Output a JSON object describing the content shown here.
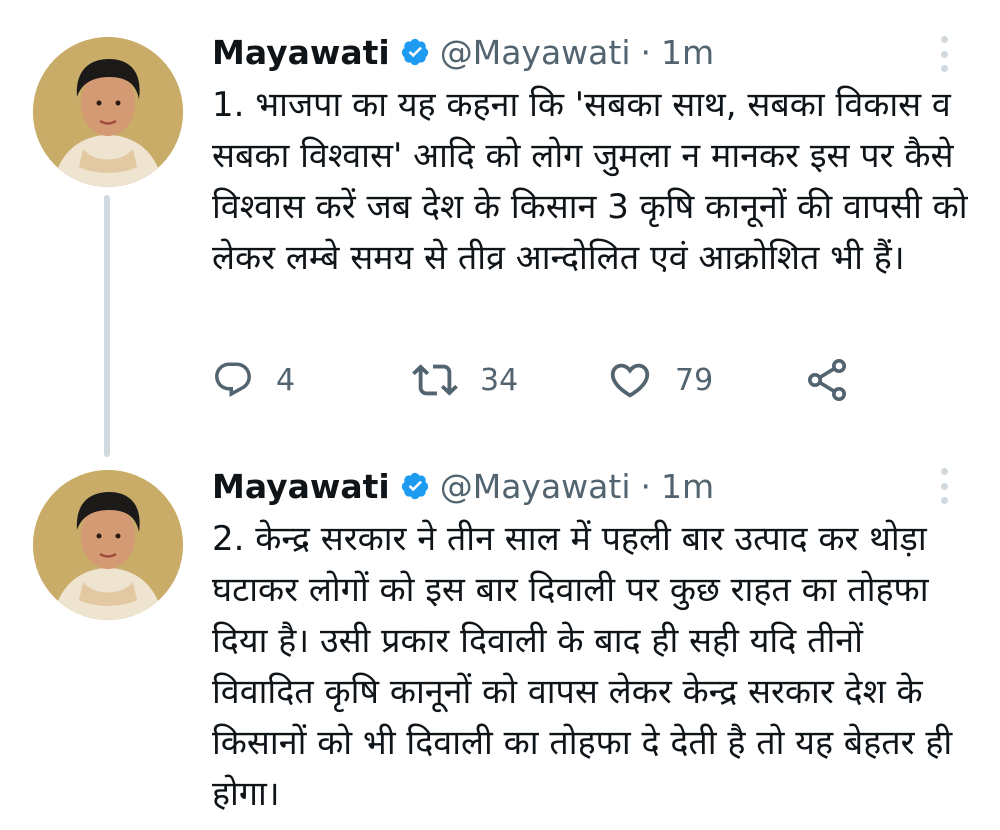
{
  "tweets": [
    {
      "name": "Mayawati",
      "handle": "@Mayawati",
      "separator": "·",
      "time": "1m",
      "text": "1. भाजपा का यह कहना कि 'सबका साथ, सबका विकास व सबका विश्वास' आदि को लोग जुमला न मानकर इस पर कैसे विश्वास करें जब देश के किसान 3 कृषि कानूनों की वापसी को लेकर लम्बे समय से तीव्र आन्दोलित एवं आक्रोशित भी हैं।",
      "reply_count": "4",
      "retweet_count": "34",
      "like_count": "79"
    },
    {
      "name": "Mayawati",
      "handle": "@Mayawati",
      "separator": "·",
      "time": "1m",
      "text": "2. केन्द्र सरकार ने तीन साल में पहली बार उत्पाद कर थोड़ा घटाकर लोगों को इस बार दिवाली पर कुछ राहत का तोहफा दिया है। उसी प्रकार दिवाली के बाद ही सही यदि तीनों विवादित कृषि कानूनों को वापस लेकर केन्द्र सरकार देश के किसानों को भी दिवाली का तोहफा दे देती है तो यह बेहतर ही होगा।"
    }
  ],
  "icons": {
    "verified": "verified-badge-icon",
    "reply": "reply-icon",
    "retweet": "retweet-icon",
    "like": "heart-icon",
    "share": "share-icon",
    "more": "more-icon"
  },
  "colors": {
    "verified": "#1d9bf0",
    "secondary_text": "#536471",
    "thread_line": "#cfd9de",
    "avatar_bg": "#c9ac68"
  }
}
